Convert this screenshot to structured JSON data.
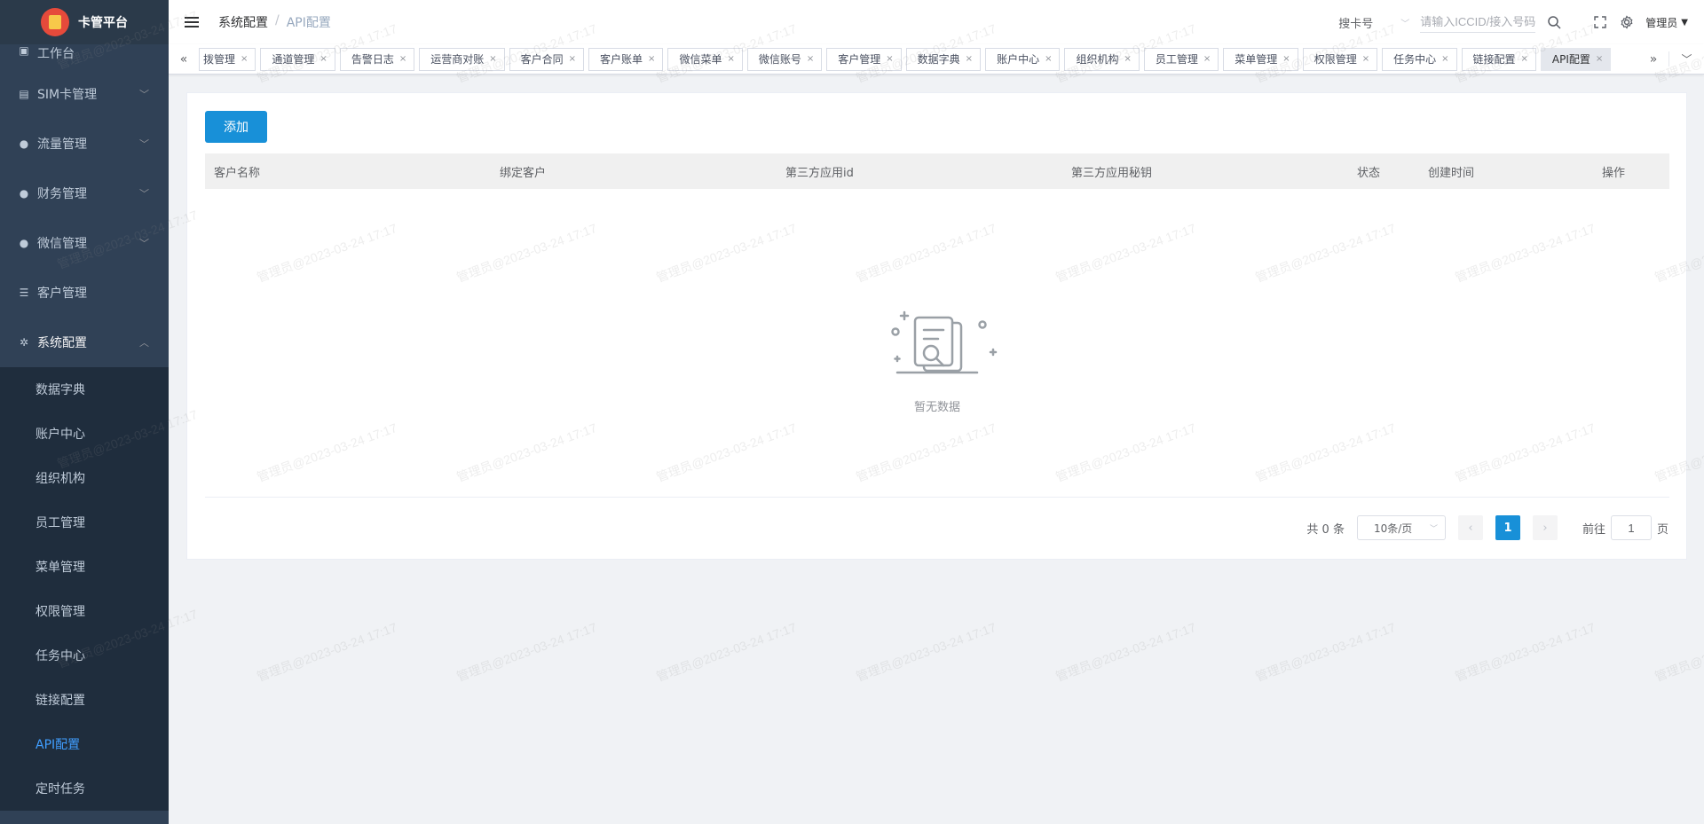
{
  "app": {
    "title": "卡管平台"
  },
  "sidebar": {
    "items": [
      {
        "label": "工作台",
        "icon": "dashboard-icon"
      },
      {
        "label": "SIM卡管理",
        "icon": "sim-card-icon"
      },
      {
        "label": "流量管理",
        "icon": "globe-icon"
      },
      {
        "label": "财务管理",
        "icon": "money-bag-icon"
      },
      {
        "label": "微信管理",
        "icon": "users-icon"
      },
      {
        "label": "客户管理",
        "icon": "list-icon"
      },
      {
        "label": "系统配置",
        "icon": "gear-icon"
      }
    ],
    "submenu": [
      {
        "label": "数据字典"
      },
      {
        "label": "账户中心"
      },
      {
        "label": "组织机构"
      },
      {
        "label": "员工管理"
      },
      {
        "label": "菜单管理"
      },
      {
        "label": "权限管理"
      },
      {
        "label": "任务中心"
      },
      {
        "label": "链接配置"
      },
      {
        "label": "API配置",
        "active": true
      },
      {
        "label": "定时任务"
      }
    ]
  },
  "navbar": {
    "breadcrumb": [
      "系统配置",
      "API配置"
    ],
    "search_type": "搜卡号",
    "search_placeholder": "请输入ICCID/接入号码",
    "user": "管理员"
  },
  "tags": [
    {
      "label": "拨管理"
    },
    {
      "label": "通道管理"
    },
    {
      "label": "告警日志"
    },
    {
      "label": "运营商对账"
    },
    {
      "label": "客户合同"
    },
    {
      "label": "客户账单"
    },
    {
      "label": "微信菜单"
    },
    {
      "label": "微信账号"
    },
    {
      "label": "客户管理"
    },
    {
      "label": "数据字典"
    },
    {
      "label": "账户中心"
    },
    {
      "label": "组织机构"
    },
    {
      "label": "员工管理"
    },
    {
      "label": "菜单管理"
    },
    {
      "label": "权限管理"
    },
    {
      "label": "任务中心"
    },
    {
      "label": "链接配置"
    },
    {
      "label": "API配置",
      "active": true
    }
  ],
  "main": {
    "add_button": "添加",
    "columns": [
      "客户名称",
      "绑定客户",
      "第三方应用id",
      "第三方应用秘钥",
      "状态",
      "创建时间",
      "操作"
    ],
    "rows": [],
    "empty_text": "暂无数据"
  },
  "pagination": {
    "total_text": "共 0 条",
    "page_size": "10条/页",
    "current_page": "1",
    "goto_label": "前往",
    "goto_value": "1",
    "page_suffix": "页"
  },
  "watermark": "管理员@2023-03-24 17:17",
  "colors": {
    "sidebar_bg": "#304156",
    "submenu_bg": "#1f2d3d",
    "accent": "#409eff",
    "primary_button": "#1890d8"
  }
}
